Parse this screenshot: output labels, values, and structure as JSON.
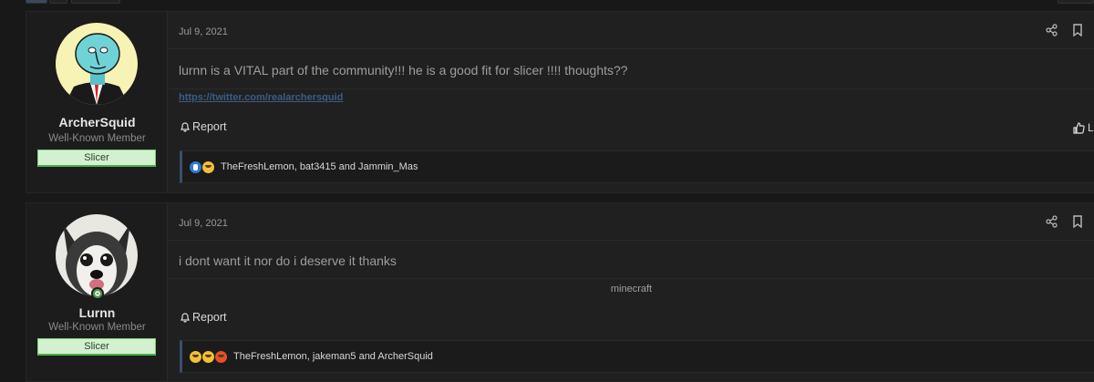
{
  "posts": [
    {
      "username": "ArcherSquid",
      "user_title": "Well-Known Member",
      "banner": "Slicer",
      "date": "Jul 9, 2021",
      "message": "lurnn is a VITAL part of the community!!! he is a good fit for slicer !!!! thoughts??",
      "link": "https://twitter.com/realarchersquid",
      "report_label": "Report",
      "like_label": "L",
      "reactions_text": "TheFreshLemon, bat3415 and Jammin_Mas"
    },
    {
      "username": "Lurnn",
      "user_title": "Well-Known Member",
      "banner": "Slicer",
      "date": "Jul 9, 2021",
      "message": "i dont want it nor do i deserve it thanks",
      "signature": "minecraft",
      "report_label": "Report",
      "reactions_text": "TheFreshLemon, jakeman5 and ArcherSquid"
    }
  ],
  "icons": [
    "share-icon",
    "bookmark-icon",
    "bell-icon",
    "thumbs-up-icon",
    "online-status-icon"
  ]
}
